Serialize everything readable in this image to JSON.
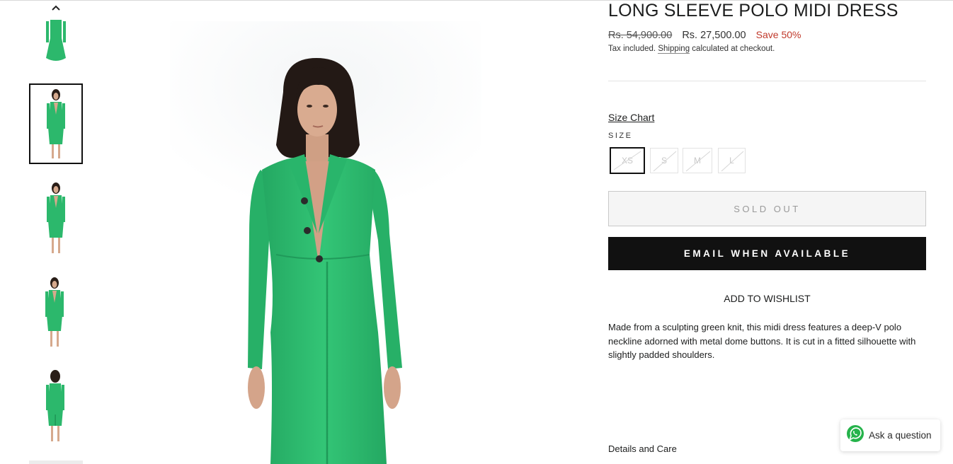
{
  "product": {
    "title": "LONG SLEEVE POLO MIDI DRESS",
    "price_original": "Rs. 54,900.00",
    "price_sale": "Rs. 27,500.00",
    "savings": "Save 50%",
    "tax_prefix": "Tax included.",
    "shipping_link": "Shipping",
    "tax_suffix": "calculated at checkout.",
    "size_chart": "Size Chart",
    "size_label": "SIZE",
    "sizes": [
      "XS",
      "S",
      "M",
      "L"
    ],
    "selected_size": "XS",
    "sold_out_label": "SOLD OUT",
    "email_label": "EMAIL WHEN AVAILABLE",
    "wishlist_label": "ADD TO WISHLIST",
    "description": "Made from a sculpting green knit, this midi dress features a deep-V polo neckline adorned with metal dome buttons. It is cut in a fitted silhouette with slightly padded shoulders.",
    "details_label": "Details and Care"
  },
  "gallery": {
    "thumbnails": [
      "front-close",
      "front-full",
      "front-full-2",
      "side-full",
      "back-full"
    ],
    "selected_index": 1
  },
  "chat": {
    "label": "Ask a question",
    "icon": "whatsapp-icon"
  },
  "colors": {
    "dress_green": "#2cb86c",
    "sale_red": "#c0392b",
    "button_black": "#111111"
  }
}
